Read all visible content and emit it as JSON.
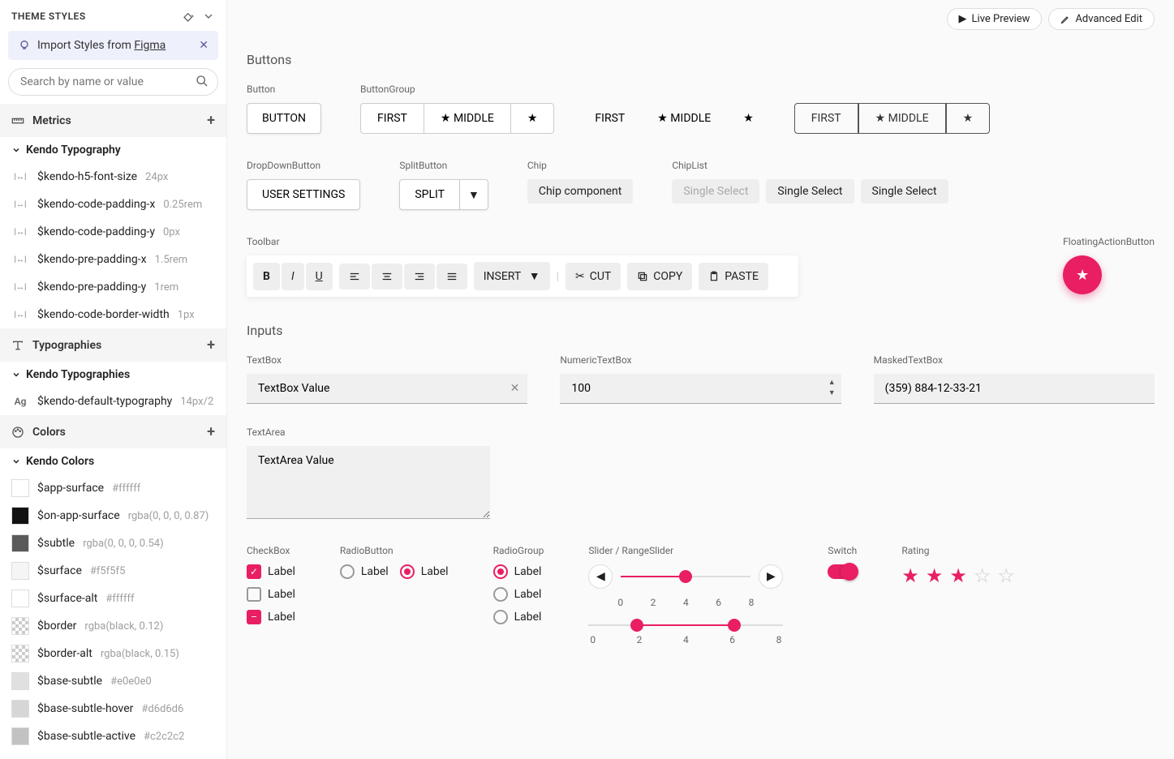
{
  "sidebar": {
    "title": "THEME STYLES",
    "import_prefix": "Import Styles from ",
    "import_link": "Figma",
    "search_placeholder": "Search by name or value",
    "sections": {
      "metrics": {
        "title": "Metrics",
        "tree": "Kendo Typography",
        "items": [
          {
            "name": "$kendo-h5-font-size",
            "val": "24px"
          },
          {
            "name": "$kendo-code-padding-x",
            "val": "0.25rem"
          },
          {
            "name": "$kendo-code-padding-y",
            "val": "0px"
          },
          {
            "name": "$kendo-pre-padding-x",
            "val": "1.5rem"
          },
          {
            "name": "$kendo-pre-padding-y",
            "val": "1rem"
          },
          {
            "name": "$kendo-code-border-width",
            "val": "1px"
          }
        ]
      },
      "typographies": {
        "title": "Typographies",
        "tree": "Kendo Typographies",
        "items": [
          {
            "name": "$kendo-default-typography",
            "val": "14px/2"
          }
        ]
      },
      "colors": {
        "title": "Colors",
        "tree": "Kendo Colors",
        "items": [
          {
            "name": "$app-surface",
            "val": "#ffffff",
            "hex": "#ffffff"
          },
          {
            "name": "$on-app-surface",
            "val": "rgba(0, 0, 0, 0.87)",
            "hex": "#121212"
          },
          {
            "name": "$subtle",
            "val": "rgba(0, 0, 0, 0.54)",
            "hex": "#5a5a5a"
          },
          {
            "name": "$surface",
            "val": "#f5f5f5",
            "hex": "#f5f5f5"
          },
          {
            "name": "$surface-alt",
            "val": "#ffffff",
            "hex": "#ffffff"
          },
          {
            "name": "$border",
            "val": "rgba(black, 0.12)",
            "hex": "checker"
          },
          {
            "name": "$border-alt",
            "val": "rgba(black, 0.15)",
            "hex": "checker"
          },
          {
            "name": "$base-subtle",
            "val": "#e0e0e0",
            "hex": "#e0e0e0"
          },
          {
            "name": "$base-subtle-hover",
            "val": "#d6d6d6",
            "hex": "#d6d6d6"
          },
          {
            "name": "$base-subtle-active",
            "val": "#c2c2c2",
            "hex": "#c2c2c2"
          }
        ]
      }
    }
  },
  "topbar": {
    "live_preview": "Live Preview",
    "advanced_edit": "Advanced Edit"
  },
  "buttons": {
    "section": "Buttons",
    "button_label": "Button",
    "button": "BUTTON",
    "group_label": "ButtonGroup",
    "first": "FIRST",
    "middle": "MIDDLE",
    "dropdown_label": "DropDownButton",
    "dropdown": "USER SETTINGS",
    "split_label": "SplitButton",
    "split": "SPLIT",
    "chip_label": "Chip",
    "chip": "Chip component",
    "chiplist_label": "ChipList",
    "chiplist": [
      "Single Select",
      "Single Select",
      "Single Select"
    ],
    "toolbar_label": "Toolbar",
    "toolbar": {
      "insert": "INSERT",
      "cut": "CUT",
      "copy": "COPY",
      "paste": "PASTE"
    },
    "fab_label": "FloatingActionButton"
  },
  "inputs": {
    "section": "Inputs",
    "textbox_label": "TextBox",
    "textbox_value": "TextBox Value",
    "numeric_label": "NumericTextBox",
    "numeric_value": "100",
    "masked_label": "MaskedTextBox",
    "masked_value": "(359) 884-12-33-21",
    "textarea_label": "TextArea",
    "textarea_value": "TextArea Value",
    "checkbox_label": "CheckBox",
    "checkbox_opts": [
      "Label",
      "Label",
      "Label"
    ],
    "radiobutton_label": "RadioButton",
    "radiobutton_opts": [
      "Label",
      "Label"
    ],
    "radiogroup_label": "RadioGroup",
    "radiogroup_opts": [
      "Label",
      "Label",
      "Label"
    ],
    "slider_label": "Slider / RangeSlider",
    "slider_ticks": [
      "0",
      "2",
      "4",
      "6",
      "8"
    ],
    "slider_value": 4,
    "range_ticks": [
      "0",
      "2",
      "4",
      "6",
      "8"
    ],
    "range_low": 2,
    "range_high": 6,
    "switch_label": "Switch",
    "rating_label": "Rating",
    "rating_value": 3,
    "rating_max": 5
  }
}
